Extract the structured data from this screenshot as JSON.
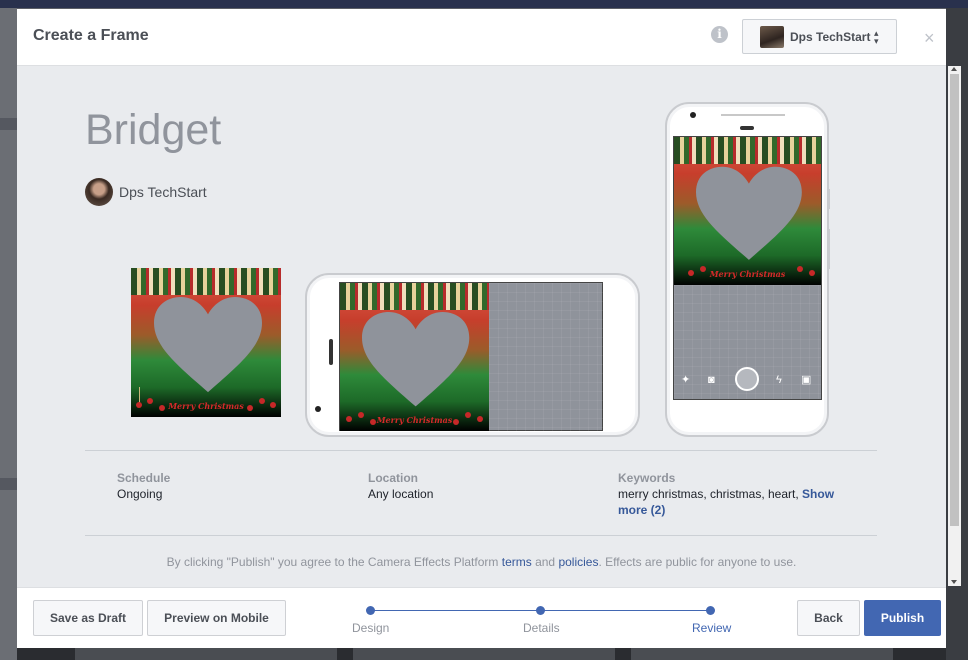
{
  "modal": {
    "title": "Create a Frame",
    "close": "×",
    "info": "i",
    "page_selector": {
      "label": "Dps TechStart",
      "caret": "▴▾"
    }
  },
  "effect": {
    "name": "Bridget",
    "creator": "Dps TechStart",
    "frame_text": "Merry Christmas"
  },
  "details": {
    "schedule": {
      "label": "Schedule",
      "value": "Ongoing"
    },
    "location": {
      "label": "Location",
      "value": "Any location"
    },
    "keywords": {
      "label": "Keywords",
      "value": "merry christmas, christmas, heart,",
      "show_more": "Show more (2)"
    }
  },
  "terms": {
    "before": "By clicking \"Publish\" you agree to the Camera Effects Platform ",
    "terms_link": "terms",
    "and": " and ",
    "policies_link": "policies",
    "after": ". Effects are public for anyone to use."
  },
  "footer": {
    "save_draft": "Save as Draft",
    "preview_mobile": "Preview on Mobile",
    "back": "Back",
    "publish": "Publish",
    "steps": [
      "Design",
      "Details",
      "Review"
    ],
    "active_step": "Review"
  },
  "colors": {
    "accent": "#4267b2",
    "link": "#365899",
    "muted": "#90949c"
  },
  "icons": [
    "info-icon",
    "close-icon",
    "caret-icon",
    "magic-wand-icon",
    "camera-icon",
    "shutter-icon",
    "flash-icon",
    "gallery-icon"
  ]
}
